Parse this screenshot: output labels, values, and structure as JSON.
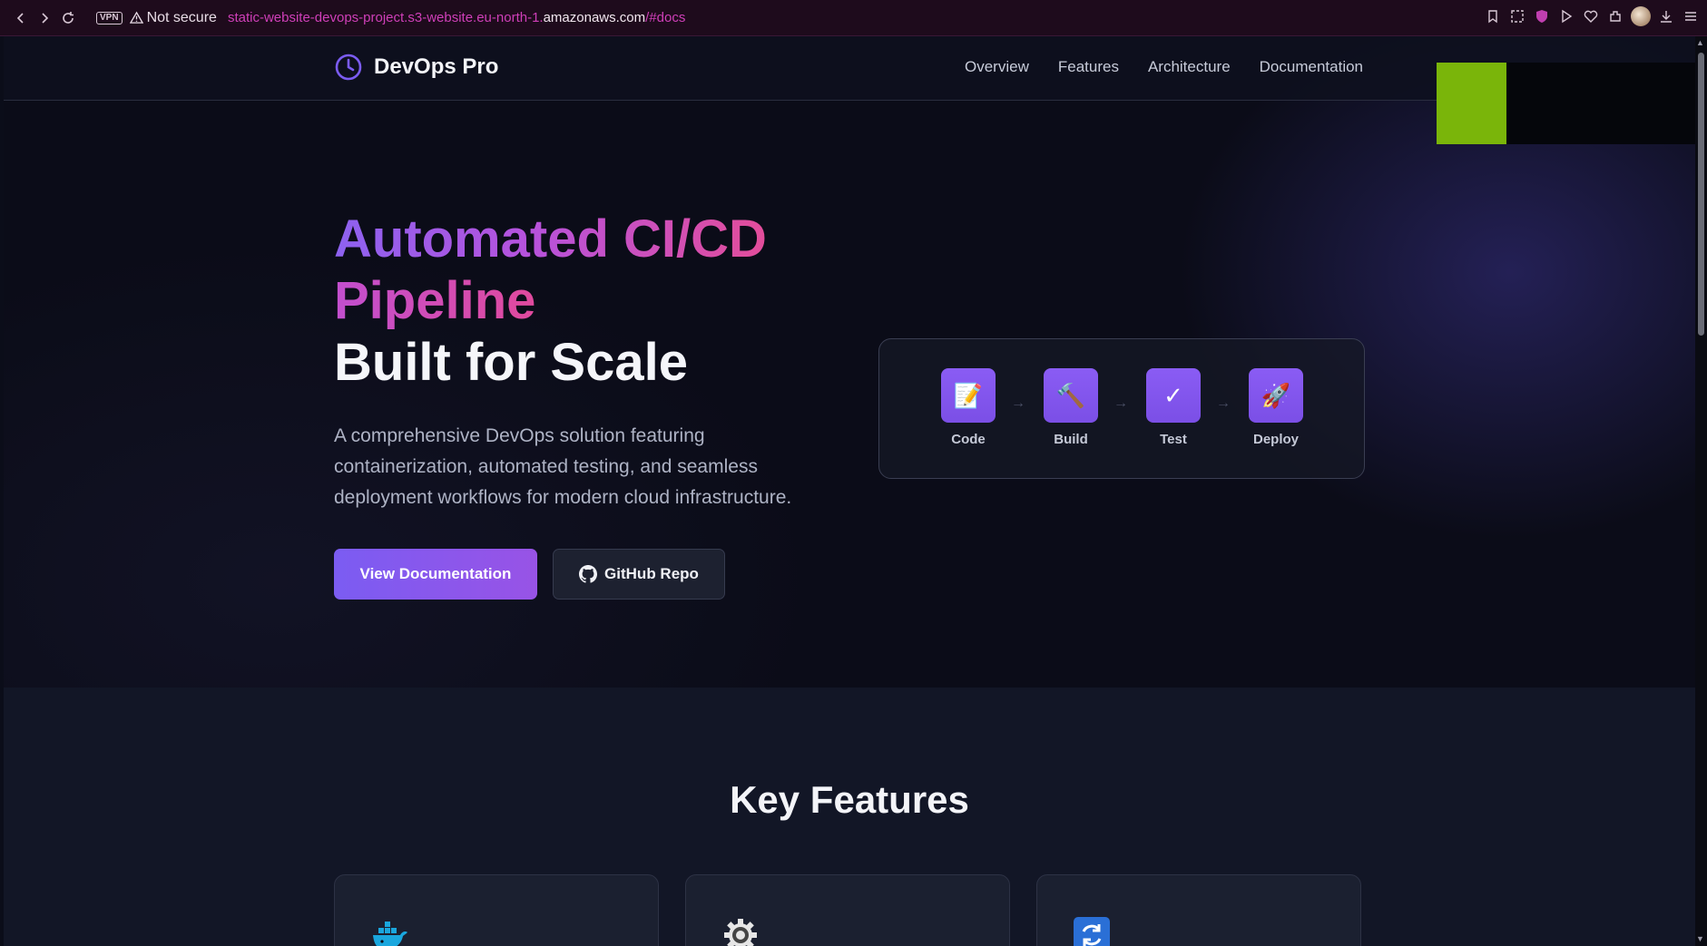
{
  "browser": {
    "vpn_label": "VPN",
    "security_label": "Not secure",
    "url_prefix": "static-website-devops-project.s3-website.eu-north-1.",
    "url_domain": "amazonaws.com",
    "url_suffix": "/#docs"
  },
  "nav": {
    "brand": "DevOps Pro",
    "links": [
      "Overview",
      "Features",
      "Architecture",
      "Documentation"
    ]
  },
  "hero": {
    "title_line1": "Automated CI/CD",
    "title_line2": "Pipeline",
    "title_line3": "Built for Scale",
    "description": "A comprehensive DevOps solution featuring containerization, automated testing, and seamless deployment workflows for modern cloud infrastructure.",
    "primary_button": "View Documentation",
    "secondary_button": "GitHub Repo",
    "pipeline_steps": [
      {
        "icon": "📝",
        "label": "Code"
      },
      {
        "icon": "🔨",
        "label": "Build"
      },
      {
        "icon": "✓",
        "label": "Test"
      },
      {
        "icon": "🚀",
        "label": "Deploy"
      }
    ],
    "arrow": "→"
  },
  "features": {
    "title": "Key Features",
    "cards": [
      {
        "icon": "docker-whale-icon"
      },
      {
        "icon": "gear-icon"
      },
      {
        "icon": "refresh-icon"
      }
    ]
  },
  "colors": {
    "accent_purple": "#7b5cf2",
    "accent_pink": "#e34d9a",
    "background": "#0b0d19",
    "url_magenta": "#cf3fb8"
  }
}
